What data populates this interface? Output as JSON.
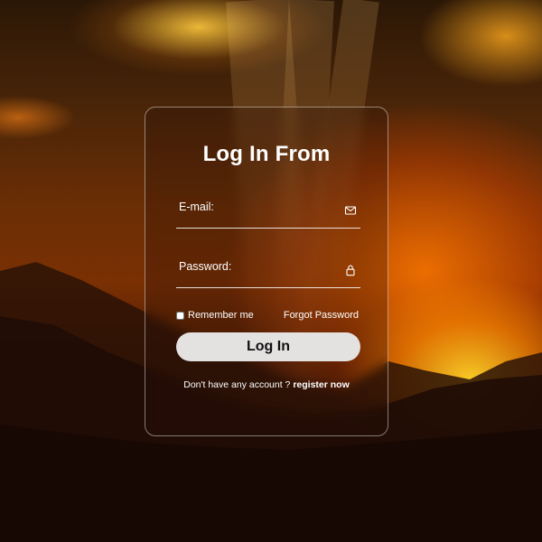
{
  "page": {
    "background": "sunset-over-forested-mountains",
    "accent_colors": {
      "sunset_orange": "#ff7a00",
      "sky_dark": "#2b1706",
      "card_border": "#ffffff",
      "button_bg": "#e4e1e1"
    }
  },
  "form": {
    "title": "Log In From",
    "email": {
      "label": "E-mail:",
      "value": "",
      "icon": "envelope-icon"
    },
    "password": {
      "label": "Password:",
      "value": "",
      "icon": "lock-icon"
    },
    "remember_label": "Remember me",
    "remember_checked": false,
    "forgot_label": "Forgot Password",
    "submit_label": "Log In",
    "register_prompt": "Don't have any account ?",
    "register_link": "register now"
  }
}
